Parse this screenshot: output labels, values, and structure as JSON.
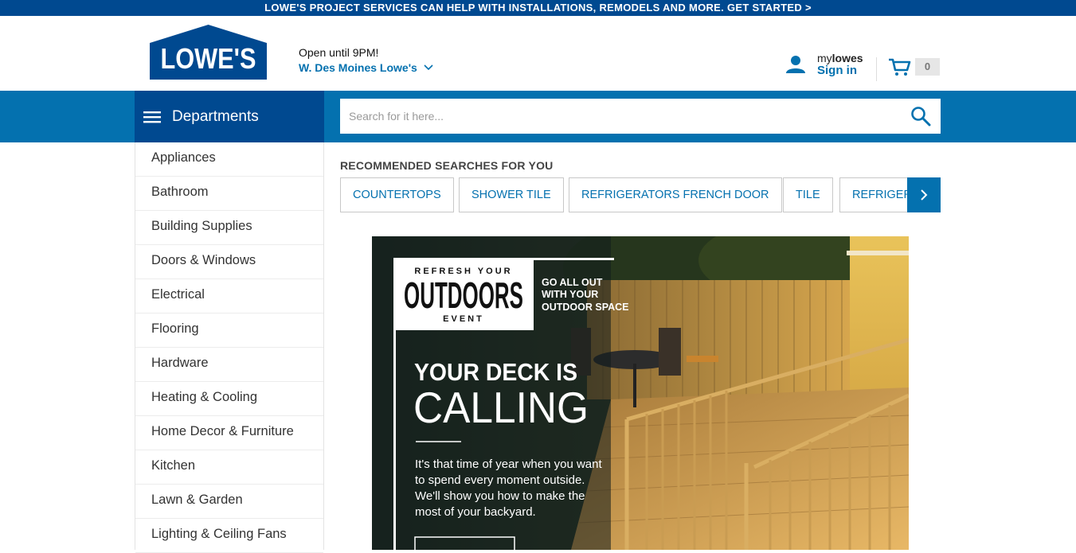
{
  "promo": {
    "text": "LOWE'S PROJECT SERVICES CAN HELP WITH INSTALLATIONS, REMODELS AND MORE. GET STARTED >"
  },
  "logo": {
    "text": "LOWE'S"
  },
  "store": {
    "hours": "Open until 9PM!",
    "name": "W. Des Moines Lowe's"
  },
  "account": {
    "my_prefix": "my",
    "my_brand": "lowes",
    "signin": "Sign in"
  },
  "cart": {
    "count": "0"
  },
  "departments": {
    "label": "Departments"
  },
  "search": {
    "placeholder": "Search for it here..."
  },
  "sidebar": {
    "items": [
      {
        "label": "Appliances"
      },
      {
        "label": "Bathroom"
      },
      {
        "label": "Building Supplies"
      },
      {
        "label": "Doors & Windows"
      },
      {
        "label": "Electrical"
      },
      {
        "label": "Flooring"
      },
      {
        "label": "Hardware"
      },
      {
        "label": "Heating & Cooling"
      },
      {
        "label": "Home Decor & Furniture"
      },
      {
        "label": "Kitchen"
      },
      {
        "label": "Lawn & Garden"
      },
      {
        "label": "Lighting & Ceiling Fans"
      }
    ]
  },
  "recommended": {
    "title": "RECOMMENDED SEARCHES FOR YOU",
    "chips": [
      {
        "label": "COUNTERTOPS"
      },
      {
        "label": "SHOWER TILE"
      },
      {
        "label": "REFRIGERATORS FRENCH DOOR"
      },
      {
        "label": "TILE"
      },
      {
        "label": "REFRIGERATORS"
      }
    ]
  },
  "hero": {
    "badge_top": "REFRESH YOUR",
    "badge_main": "OUTDOORS",
    "badge_bottom": "EVENT",
    "tagline": [
      "GO ALL OUT",
      "WITH YOUR",
      "OUTDOOR SPACE"
    ],
    "headline1": "YOUR DECK IS",
    "headline2": "CALLING",
    "body": [
      "It's that time of year when you want",
      "to spend every moment outside.",
      "We'll show you how to make the",
      "most of your backyard."
    ]
  },
  "colors": {
    "lowes_blue": "#004990",
    "accent_blue": "#0471af"
  }
}
